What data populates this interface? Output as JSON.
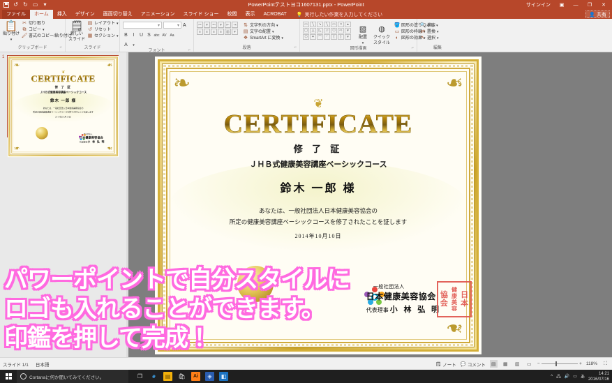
{
  "titlebar": {
    "title": "PowerPointテストヨコ1607131.pptx - PowerPoint",
    "signin": "サインイン",
    "qat": {
      "save": "save-icon",
      "undo": "↺",
      "redo": "↻",
      "present": "▭",
      "more": "▾"
    },
    "minimize": "―",
    "restore": "❐",
    "close": "✕",
    "ribbon_display": "▣"
  },
  "tabs": [
    {
      "label": "ファイル",
      "type": "file"
    },
    {
      "label": "ホーム",
      "type": "active"
    },
    {
      "label": "挿入",
      "type": "normal"
    },
    {
      "label": "デザイン",
      "type": "normal"
    },
    {
      "label": "画面切り替え",
      "type": "normal"
    },
    {
      "label": "アニメーション",
      "type": "normal"
    },
    {
      "label": "スライド ショー",
      "type": "normal"
    },
    {
      "label": "校閲",
      "type": "normal"
    },
    {
      "label": "表示",
      "type": "normal"
    },
    {
      "label": "ACROBAT",
      "type": "normal"
    }
  ],
  "tellme": {
    "placeholder": "実行したい作業を入力してください",
    "icon": "💡"
  },
  "share": {
    "label": "共有",
    "icon": "👤"
  },
  "ribbon": {
    "clipboard": {
      "group_label": "クリップボード",
      "paste": "貼り付け",
      "cut": "切り取り",
      "copy": "コピー",
      "format_painter": "書式のコピー/貼り付け"
    },
    "slides": {
      "group_label": "スライド",
      "new_slide": "新しい\nスライド",
      "new_slide_l1": "新しい",
      "new_slide_l2": "スライド",
      "layout": "レイアウト",
      "reset": "リセット",
      "section": "セクション"
    },
    "font": {
      "group_label": "フォント",
      "font_name": "",
      "font_size": "",
      "bold": "B",
      "italic": "I",
      "underline": "U",
      "shadow": "S",
      "strikethrough": "abc",
      "spacing": "AV",
      "case": "Aa"
    },
    "paragraph": {
      "group_label": "段落",
      "text_direction": "文字列の方向",
      "align_text": "文字の配置",
      "convert_smartart": "SmartArt に変換"
    },
    "drawing": {
      "group_label": "図形描画",
      "arrange": "配置",
      "quick_styles_l1": "クイック",
      "quick_styles_l2": "スタイル",
      "shape_fill": "図形の塗りつぶし",
      "shape_outline": "図形の枠線",
      "shape_effects": "図形の効果"
    },
    "editing": {
      "group_label": "編集",
      "find": "検索",
      "replace": "置換",
      "select": "選択"
    }
  },
  "thumbnail": {
    "number": "1"
  },
  "certificate": {
    "title": "CERTIFICATE",
    "subtitle": "修 了 証",
    "course": "ＪＨＢ式健康美容講座ベーシックコース",
    "recipient": "鈴木 一郎 様",
    "body_line1": "あなたは、一般社団法人日本健康美容協会の",
    "body_line2": "所定の健康美容講座ベーシックコースを修了されたことを証します",
    "date": "2014年10月10日",
    "org_prefix": "一般社団法人",
    "org_name": "日本健康美容協会",
    "role": "代表理事",
    "signer": "小 林 弘 明",
    "seal_chars": [
      "協",
      "健",
      "日",
      "会",
      "康",
      "本",
      "美",
      "容"
    ],
    "seal_col1": [
      "協",
      "会"
    ],
    "seal_col2": [
      "健",
      "康",
      "美",
      "容"
    ],
    "seal_col3": [
      "日",
      "本"
    ]
  },
  "overlay_caption": {
    "line1": "パワーポイントで自分スタイルに",
    "line2": "ロゴも入れることができます。",
    "line3": "印鑑を押して完成！",
    "fill_color": "#ffffff",
    "stroke_color": "#ff6ae0"
  },
  "statusbar": {
    "slide_count": "スライド 1/1",
    "language": "日本語",
    "notes": "ノート",
    "comments": "コメント",
    "zoom_level": "118%",
    "views": [
      "normal-view",
      "slide-sorter-view",
      "reading-view",
      "slideshow-view"
    ],
    "fit_slide": "⛶"
  },
  "taskbar": {
    "cortana_placeholder": "Cortanaに何か聞いてみてください。",
    "time": "14:21",
    "date": "2016/07/16",
    "ime": "あ",
    "apps": [
      {
        "name": "task-view",
        "glyph": "❐",
        "color": "#1f1f1f"
      },
      {
        "name": "edge",
        "glyph": "e",
        "color": "#0b7fc6"
      },
      {
        "name": "file-explorer",
        "glyph": "▤",
        "color": "#f3b10b"
      },
      {
        "name": "store",
        "glyph": "🛍",
        "color": "#2a2a2a"
      },
      {
        "name": "illustrator",
        "glyph": "Ai",
        "color": "#ff7f18"
      },
      {
        "name": "photoshop-blue",
        "glyph": "◈",
        "color": "#2a5db0"
      },
      {
        "name": "office-app",
        "glyph": "◧",
        "color": "#1b72c0"
      }
    ]
  },
  "colors": {
    "accent": "#b7472a",
    "ribbon_bg": "#f1f1f1",
    "stage_bg": "#7e7e7e",
    "gold": "#d4af37",
    "seal_red": "#e0564f"
  }
}
